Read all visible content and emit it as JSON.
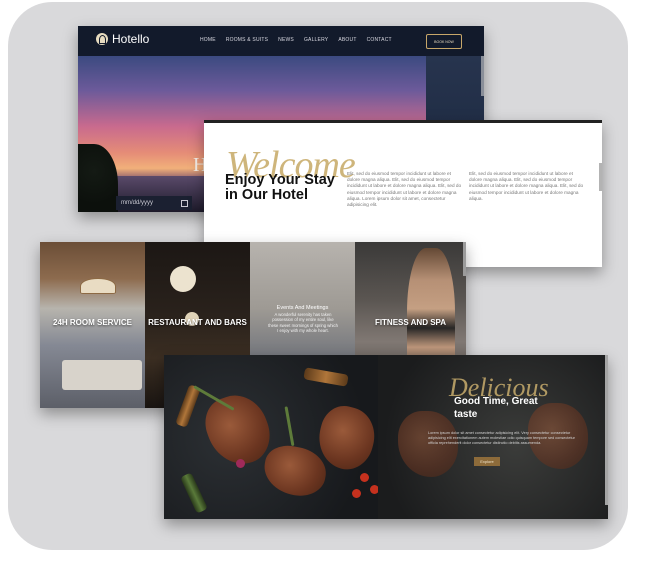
{
  "hero": {
    "brand": "Hotello",
    "nav": [
      "HOME",
      "ROOMS & SUITS",
      "NEWS",
      "GALLERY",
      "ABOUT",
      "CONTACT"
    ],
    "cta_label": "BOOK NOW",
    "hero_letter": "H",
    "date_placeholder": "mm/dd/yyyy"
  },
  "welcome": {
    "script_word": "Welcome",
    "heading": "Enjoy Your Stay in Our Hotel",
    "col1": "Elit, sed do eiusmod tempor incididunt ut labore et dolore magna aliqua. Elit, sed do eiusmod tempor incididunt ut labore et dolore magna aliqua. Elit, sed do eiusmod tempor incididunt ut labore et dolore magna aliqua. Lorem ipsum dolor sit amet, consectetur adipisicing elit.",
    "col2": "Elit, sed do eiusmod tempor incididunt ut labore et dolore magna aliqua. Elit, sed do eiusmod tempor incididunt ut labore et dolore magna aliqua. Elit, sed do eiusmod tempor incididunt ut labore et dolore magna aliqua."
  },
  "amenities": {
    "panel1": "24H ROOM SERVICE",
    "panel2": "RESTAURANT AND BARS",
    "panel3_title": "Events And Meetings",
    "panel3_text": "A wonderful serenity has taken possession of my entire soul, like these sweet mornings of spring which I enjoy with my whole heart.",
    "panel4": "FITNESS AND SPA"
  },
  "food": {
    "script_word": "Delicious",
    "heading": "Good Time, Great taste",
    "lorem": "Lorem ipsum dolor sit amet consectetur adipisicing elit. Very consectetur consectetur adipisicing elit exercitationem autem molestiae odio quisquam tempore sed consectetur officia reprehenderit dolor consectetur distinctio debitis assumenda.",
    "cta_label": "Explore"
  },
  "colors": {
    "accent_gold": "#c9ad6d",
    "navbar": "#121a2b",
    "backdrop": "#d9d9db"
  }
}
